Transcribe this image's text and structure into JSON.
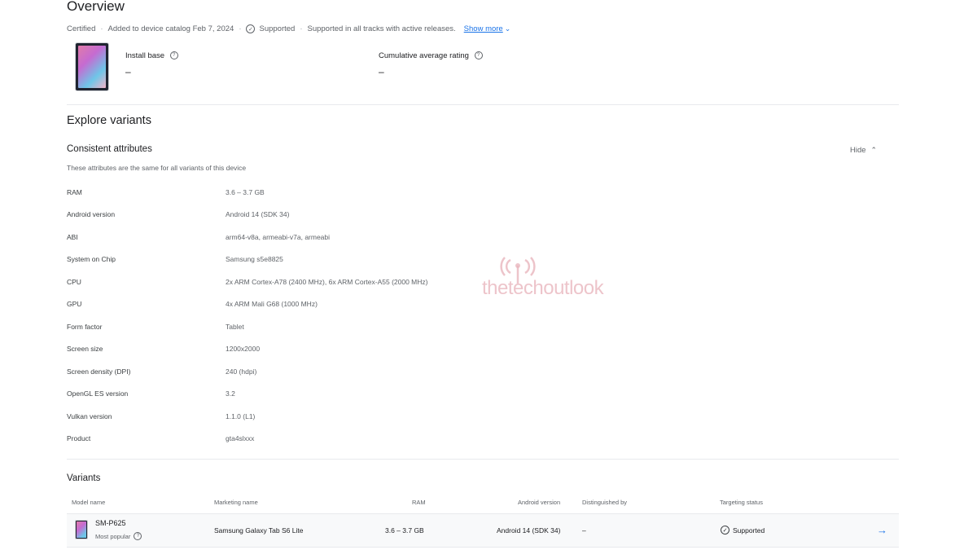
{
  "overview": {
    "title": "Overview",
    "certified": "Certified",
    "added": "Added to device catalog Feb 7, 2024",
    "supported": "Supported",
    "tracks": "Supported in all tracks with active releases.",
    "show_more": "Show more",
    "install_base_label": "Install base",
    "install_base_value": "–",
    "rating_label": "Cumulative average rating",
    "rating_value": "–"
  },
  "explore": {
    "title": "Explore variants",
    "consistent_title": "Consistent attributes",
    "hide_label": "Hide",
    "description": "These attributes are the same for all variants of this device",
    "attributes": [
      {
        "key": "RAM",
        "value": "3.6 – 3.7 GB"
      },
      {
        "key": "Android version",
        "value": "Android 14 (SDK 34)"
      },
      {
        "key": "ABI",
        "value": "arm64-v8a, armeabi-v7a, armeabi"
      },
      {
        "key": "System on Chip",
        "value": "Samsung s5e8825"
      },
      {
        "key": "CPU",
        "value": "2x ARM Cortex-A78 (2400 MHz), 6x ARM Cortex-A55 (2000 MHz)"
      },
      {
        "key": "GPU",
        "value": "4x ARM Mali G68 (1000 MHz)"
      },
      {
        "key": "Form factor",
        "value": "Tablet"
      },
      {
        "key": "Screen size",
        "value": "1200x2000"
      },
      {
        "key": "Screen density (DPI)",
        "value": "240 (hdpi)"
      },
      {
        "key": "OpenGL ES version",
        "value": "3.2"
      },
      {
        "key": "Vulkan version",
        "value": "1.1.0 (L1)"
      },
      {
        "key": "Product",
        "value": "gta4slxxx"
      }
    ]
  },
  "variants": {
    "title": "Variants",
    "columns": {
      "model": "Model name",
      "marketing": "Marketing name",
      "ram": "RAM",
      "android": "Android version",
      "distinguished": "Distinguished by",
      "targeting": "Targeting status"
    },
    "rows": [
      {
        "model": "SM-P625",
        "popular": "Most popular",
        "marketing": "Samsung Galaxy Tab S6 Lite",
        "ram": "3.6 – 3.7 GB",
        "android": "Android 14 (SDK 34)",
        "distinguished": "–",
        "targeting": "Supported"
      }
    ]
  },
  "watermark": "thetechoutlook",
  "icons": {
    "supported": "check-circle-icon",
    "help": "help-circle-icon",
    "expand": "chevron-down-icon",
    "collapse": "chevron-up-icon",
    "navigate": "arrow-right-icon"
  },
  "colors": {
    "link": "#1a73e8",
    "text": "#202124",
    "secondary": "#5f6368",
    "watermark": "#e9b6be"
  }
}
